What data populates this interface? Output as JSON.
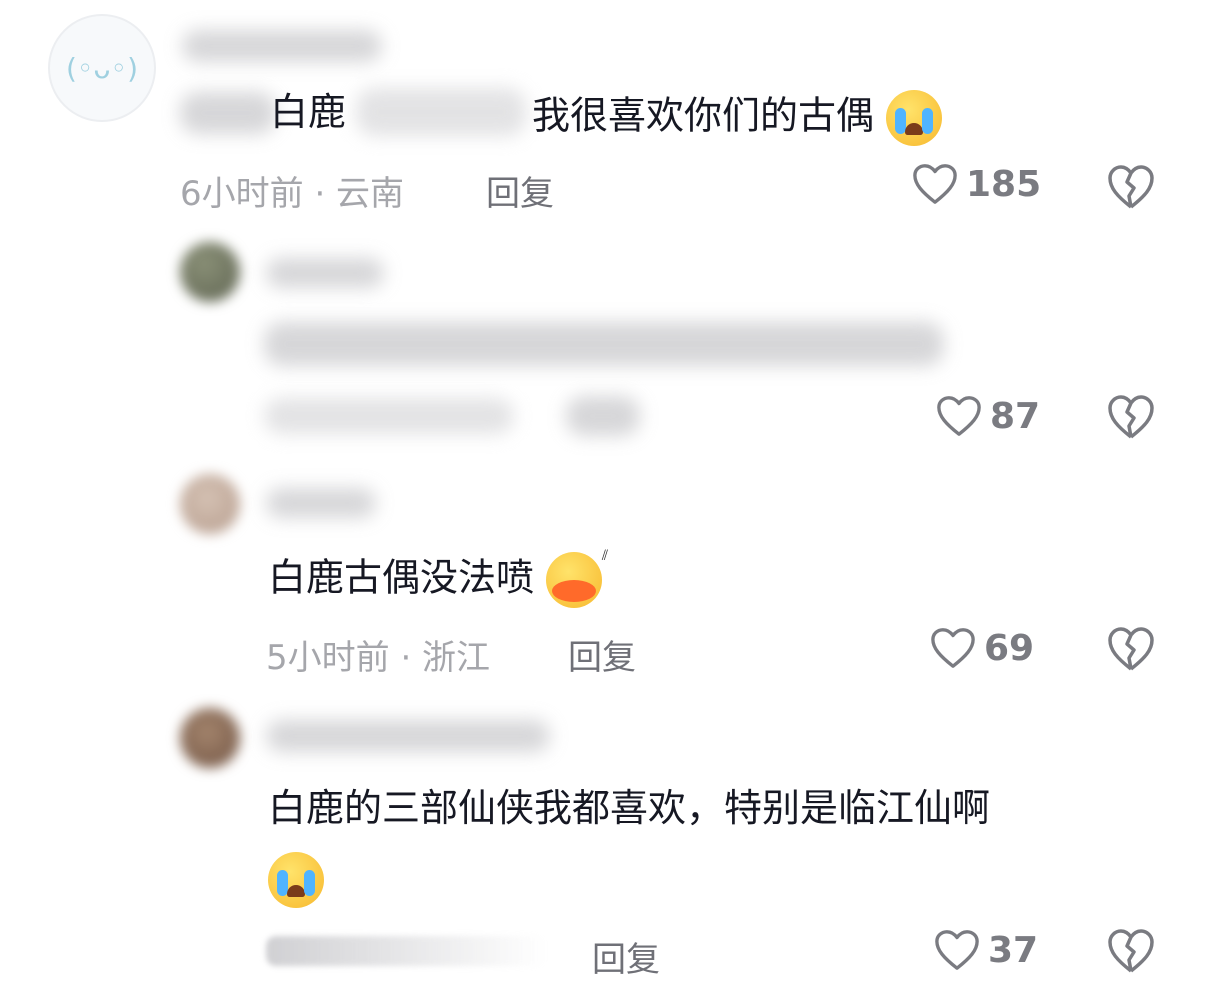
{
  "comments": [
    {
      "text_visible_1": "白鹿",
      "text_visible_2": "我很喜欢你们的古偶",
      "emoji": "crying-face",
      "time_location": "6小时前 · 云南",
      "reply_label": "回复",
      "likes": "185"
    },
    {
      "likes": "87"
    },
    {
      "text": "白鹿古偶没法喷",
      "emoji": "duck-face",
      "time_location": "5小时前 · 浙江",
      "reply_label": "回复",
      "likes": "69"
    },
    {
      "text": "白鹿的三部仙侠我都喜欢，特别是临江仙啊",
      "emoji": "crying-face",
      "reply_label": "回复",
      "likes": "37"
    }
  ],
  "icons": {
    "like": "heart-outline-icon",
    "dislike": "broken-heart-icon"
  },
  "colors": {
    "text": "#161823",
    "meta": "#a5a6ab",
    "reply": "#6f7077",
    "count": "#7a7b81"
  }
}
